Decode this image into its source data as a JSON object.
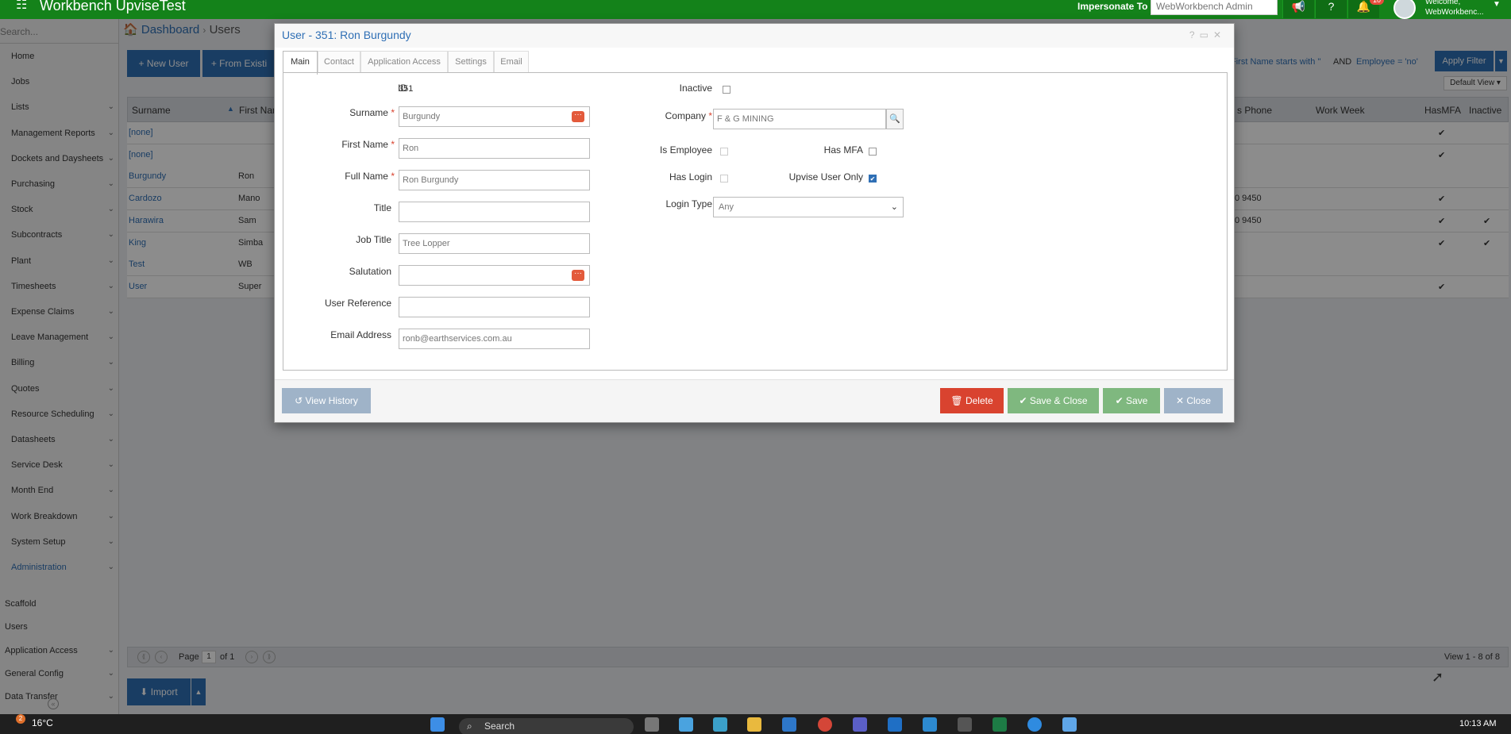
{
  "app": {
    "title": "Workbench UpviseTest"
  },
  "topbar": {
    "impersonate_label": "Impersonate To",
    "impersonate_value": "WebWorkbench Admin",
    "notification_count": "10",
    "welcome_line1": "Welcome,",
    "welcome_line2": "WebWorkbenc..."
  },
  "sidebar": {
    "search_placeholder": "Search...",
    "items": [
      {
        "label": "Home",
        "expandable": false
      },
      {
        "label": "Jobs",
        "expandable": false
      },
      {
        "label": "Lists",
        "expandable": true
      },
      {
        "label": "Management Reports",
        "expandable": true
      },
      {
        "label": "Dockets and Daysheets",
        "expandable": true
      },
      {
        "label": "Purchasing",
        "expandable": true
      },
      {
        "label": "Stock",
        "expandable": true
      },
      {
        "label": "Subcontracts",
        "expandable": true
      },
      {
        "label": "Plant",
        "expandable": true
      },
      {
        "label": "Timesheets",
        "expandable": true
      },
      {
        "label": "Expense Claims",
        "expandable": true
      },
      {
        "label": "Leave Management",
        "expandable": true
      },
      {
        "label": "Billing",
        "expandable": true
      },
      {
        "label": "Quotes",
        "expandable": true
      },
      {
        "label": "Resource Scheduling",
        "expandable": true
      },
      {
        "label": "Datasheets",
        "expandable": true
      },
      {
        "label": "Service Desk",
        "expandable": true
      },
      {
        "label": "Month End",
        "expandable": true
      },
      {
        "label": "Work Breakdown",
        "expandable": true
      },
      {
        "label": "System Setup",
        "expandable": true
      },
      {
        "label": "Administration",
        "expandable": true
      }
    ],
    "sub_items": [
      {
        "label": "Scaffold",
        "expandable": false
      },
      {
        "label": "Users",
        "expandable": false
      },
      {
        "label": "Application Access",
        "expandable": true
      },
      {
        "label": "General Config",
        "expandable": true
      },
      {
        "label": "Data Transfer",
        "expandable": true
      }
    ]
  },
  "breadcrumb": {
    "root": "Dashboard",
    "current": "Users"
  },
  "toolbar": {
    "new_user": "New User",
    "from_existing": "From Existi",
    "apply_filter": "Apply Filter",
    "default_view": "Default View",
    "filter_part1": "First Name starts with ''",
    "filter_and": "AND",
    "filter_part2": "Employee = 'no'"
  },
  "grid": {
    "headers": {
      "surname": "Surname",
      "first_name": "First Nam",
      "phone": "s Phone",
      "work_week": "Work Week",
      "has_mfa": "HasMFA",
      "inactive": "Inactive"
    },
    "rows": [
      {
        "surname": "[none]",
        "first": "",
        "phone": "",
        "mfa": "✔",
        "inactive": ""
      },
      {
        "surname": "[none]",
        "first": "",
        "phone": "",
        "mfa": "✔",
        "inactive": ""
      },
      {
        "surname": "Burgundy",
        "first": "Ron",
        "phone": "",
        "mfa": "",
        "inactive": ""
      },
      {
        "surname": "Cardozo",
        "first": "Mano",
        "phone": "0 9450",
        "mfa": "✔",
        "inactive": ""
      },
      {
        "surname": "Harawira",
        "first": "Sam",
        "phone": "0 9450",
        "mfa": "✔",
        "inactive": "✔"
      },
      {
        "surname": "King",
        "first": "Simba",
        "phone": "",
        "mfa": "✔",
        "inactive": "✔"
      },
      {
        "surname": "Test",
        "first": "WB",
        "phone": "",
        "mfa": "",
        "inactive": ""
      },
      {
        "surname": "User",
        "first": "Super",
        "phone": "",
        "mfa": "✔",
        "inactive": ""
      }
    ]
  },
  "pager": {
    "page_label": "Page",
    "page": "1",
    "of": "of 1",
    "view": "View 1 - 8 of 8"
  },
  "import_label": "Import",
  "modal": {
    "title": "User - 351: Ron Burgundy",
    "tabs": [
      "Main",
      "Contact",
      "Application Access",
      "Settings",
      "Email"
    ],
    "fields": {
      "id_label": "ID",
      "id_value": "351",
      "surname_label": "Surname",
      "surname_value": "Burgundy",
      "first_name_label": "First Name",
      "first_name_value": "Ron",
      "full_name_label": "Full Name",
      "full_name_value": "Ron Burgundy",
      "title_label": "Title",
      "title_value": "",
      "job_title_label": "Job Title",
      "job_title_value": "Tree Lopper",
      "salutation_label": "Salutation",
      "salutation_value": "",
      "user_ref_label": "User Reference",
      "user_ref_value": "",
      "email_label": "Email Address",
      "email_value": "ronb@earthservices.com.au",
      "inactive_label": "Inactive",
      "company_label": "Company",
      "company_value": "F & G MINING",
      "is_employee_label": "Is Employee",
      "has_mfa_label": "Has MFA",
      "has_login_label": "Has Login",
      "upvise_only_label": "Upvise User Only",
      "login_type_label": "Login Type",
      "login_type_value": "Any"
    },
    "buttons": {
      "history": "View History",
      "delete": "Delete",
      "save_close": "Save & Close",
      "save": "Save",
      "close": "Close"
    }
  },
  "taskbar": {
    "weather": "16°C",
    "weather_badge": "2",
    "search": "Search",
    "time": "10:13 AM"
  }
}
